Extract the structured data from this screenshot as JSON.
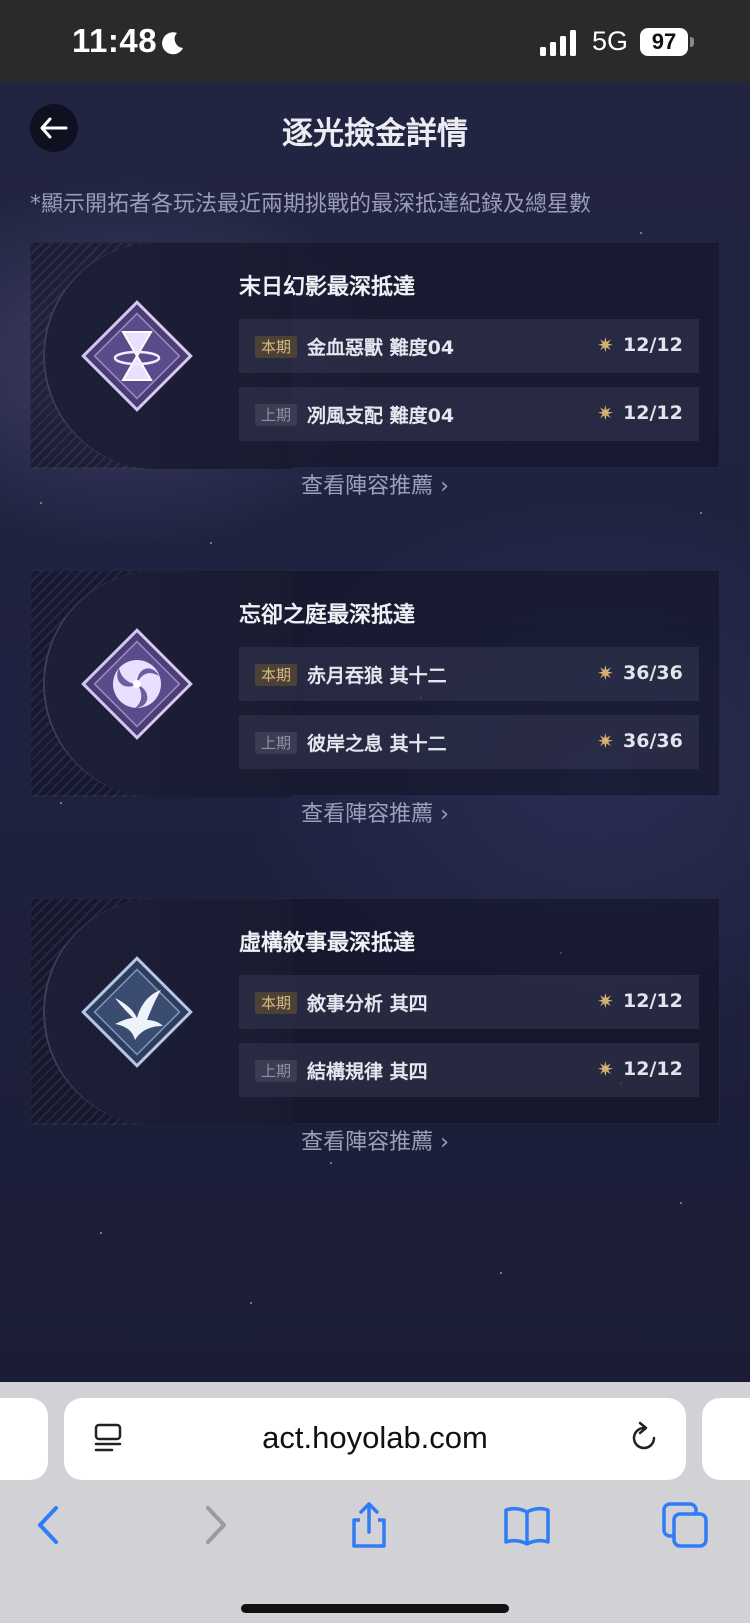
{
  "status_bar": {
    "time": "11:48",
    "network": "5G",
    "battery": "97"
  },
  "header": {
    "title": "逐光撿金詳情",
    "back_icon": "back-arrow-icon"
  },
  "note": "*顯示開拓者各玩法最近兩期挑戰的最深抵達紀錄及總星數",
  "cards": [
    {
      "title": "末日幻影最深抵達",
      "emblem": "hourglass-emblem-icon",
      "rows": [
        {
          "tag": "本期",
          "name": "金血惡獸 難度04",
          "score": "12/12"
        },
        {
          "tag": "上期",
          "name": "冽風支配 難度04",
          "score": "12/12"
        }
      ],
      "link": "查看陣容推薦"
    },
    {
      "title": "忘卻之庭最深抵達",
      "emblem": "spiral-emblem-icon",
      "rows": [
        {
          "tag": "本期",
          "name": "赤月吞狼 其十二",
          "score": "36/36"
        },
        {
          "tag": "上期",
          "name": "彼岸之息 其十二",
          "score": "36/36"
        }
      ],
      "link": "查看陣容推薦"
    },
    {
      "title": "虛構敘事最深抵達",
      "emblem": "bird-emblem-icon",
      "rows": [
        {
          "tag": "本期",
          "name": "敘事分析 其四",
          "score": "12/12"
        },
        {
          "tag": "上期",
          "name": "結構規律 其四",
          "score": "12/12"
        }
      ],
      "link": "查看陣容推薦"
    }
  ],
  "browser": {
    "url": "act.hoyolab.com"
  },
  "colors": {
    "accent_gold": "#d8b070",
    "background": "#1f2240"
  }
}
